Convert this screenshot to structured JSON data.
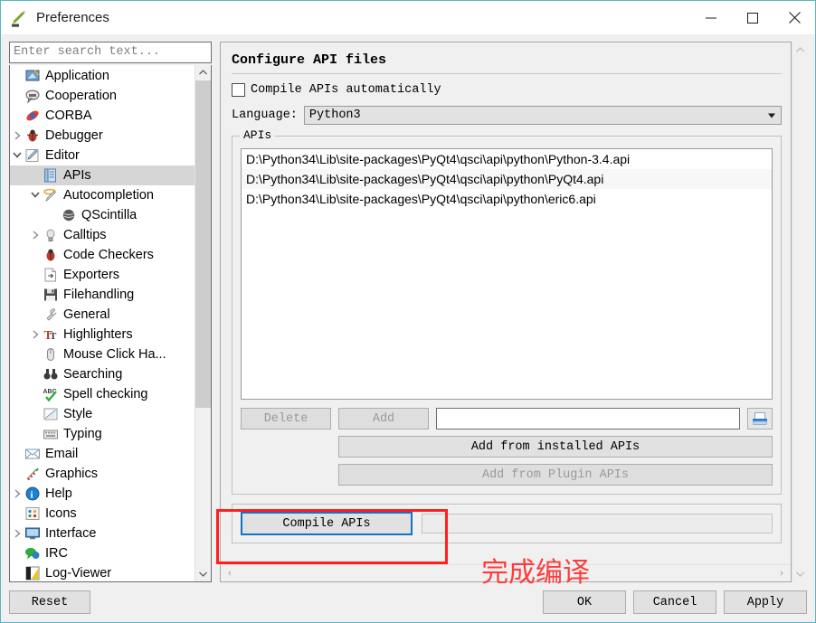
{
  "window": {
    "title": "Preferences",
    "app_icon": "eric6-pen-icon",
    "controls": {
      "minimize": "minimize-icon",
      "maximize": "maximize-icon",
      "close": "close-icon"
    }
  },
  "sidebar": {
    "search_placeholder": "Enter search text...",
    "search_value": "",
    "items": [
      {
        "label": "Application",
        "level": 0,
        "twisty": "",
        "icon": "application-icon",
        "selected": false
      },
      {
        "label": "Cooperation",
        "level": 0,
        "twisty": "",
        "icon": "cooperation-icon",
        "selected": false
      },
      {
        "label": "CORBA",
        "level": 0,
        "twisty": "",
        "icon": "corba-icon",
        "selected": false
      },
      {
        "label": "Debugger",
        "level": 0,
        "twisty": "›",
        "icon": "debugger-bug-icon",
        "selected": false
      },
      {
        "label": "Editor",
        "level": 0,
        "twisty": "⌄",
        "icon": "editor-pencil-icon",
        "selected": false
      },
      {
        "label": "APIs",
        "level": 1,
        "twisty": "",
        "icon": "apis-icon",
        "selected": true
      },
      {
        "label": "Autocompletion",
        "level": 1,
        "twisty": "⌄",
        "icon": "autocompletion-icon",
        "selected": false
      },
      {
        "label": "QScintilla",
        "level": 2,
        "twisty": "",
        "icon": "qscintilla-icon",
        "selected": false
      },
      {
        "label": "Calltips",
        "level": 1,
        "twisty": "›",
        "icon": "calltips-bulb-icon",
        "selected": false
      },
      {
        "label": "Code Checkers",
        "level": 1,
        "twisty": "",
        "icon": "code-checkers-icon",
        "selected": false
      },
      {
        "label": "Exporters",
        "level": 1,
        "twisty": "",
        "icon": "exporters-icon",
        "selected": false
      },
      {
        "label": "Filehandling",
        "level": 1,
        "twisty": "",
        "icon": "filehandling-icon",
        "selected": false
      },
      {
        "label": "General",
        "level": 1,
        "twisty": "",
        "icon": "general-wrench-icon",
        "selected": false
      },
      {
        "label": "Highlighters",
        "level": 1,
        "twisty": "›",
        "icon": "highlighters-icon",
        "selected": false
      },
      {
        "label": "Mouse Click Ha...",
        "level": 1,
        "twisty": "",
        "icon": "mouse-icon",
        "selected": false
      },
      {
        "label": "Searching",
        "level": 1,
        "twisty": "",
        "icon": "searching-binoculars-icon",
        "selected": false
      },
      {
        "label": "Spell checking",
        "level": 1,
        "twisty": "",
        "icon": "spell-checking-icon",
        "selected": false
      },
      {
        "label": "Style",
        "level": 1,
        "twisty": "",
        "icon": "style-icon",
        "selected": false
      },
      {
        "label": "Typing",
        "level": 1,
        "twisty": "",
        "icon": "typing-keyboard-icon",
        "selected": false
      },
      {
        "label": "Email",
        "level": 0,
        "twisty": "",
        "icon": "email-icon",
        "selected": false
      },
      {
        "label": "Graphics",
        "level": 0,
        "twisty": "",
        "icon": "graphics-icon",
        "selected": false
      },
      {
        "label": "Help",
        "level": 0,
        "twisty": "›",
        "icon": "help-icon",
        "selected": false
      },
      {
        "label": "Icons",
        "level": 0,
        "twisty": "",
        "icon": "icons-icon",
        "selected": false
      },
      {
        "label": "Interface",
        "level": 0,
        "twisty": "›",
        "icon": "interface-monitor-icon",
        "selected": false
      },
      {
        "label": "IRC",
        "level": 0,
        "twisty": "",
        "icon": "irc-icon",
        "selected": false
      },
      {
        "label": "Log-Viewer",
        "level": 0,
        "twisty": "",
        "icon": "log-viewer-icon",
        "selected": false
      }
    ]
  },
  "main": {
    "pane_title": "Configure API files",
    "compile_auto": {
      "label": "Compile APIs automatically",
      "checked": false
    },
    "language": {
      "label": "Language:",
      "value": "Python3"
    },
    "apis_group": {
      "legend": "APIs",
      "files": [
        "D:\\Python34\\Lib\\site-packages\\PyQt4\\qsci\\api\\python\\Python-3.4.api",
        "D:\\Python34\\Lib\\site-packages\\PyQt4\\qsci\\api\\python\\PyQt4.api",
        "D:\\Python34\\Lib\\site-packages\\PyQt4\\qsci\\api\\python\\eric6.api"
      ],
      "delete_label": "Delete",
      "delete_enabled": false,
      "add_label": "Add",
      "add_enabled": false,
      "path_value": "",
      "browse_icon": "open-folder-icon",
      "add_installed_label": "Add from installed APIs",
      "add_installed_enabled": true,
      "add_plugin_label": "Add from Plugin APIs",
      "add_plugin_enabled": false
    },
    "compile_group": {
      "button_label": "Compile APIs",
      "button_focused": true,
      "progress_value": 0
    },
    "annotation": {
      "text": "完成编译",
      "color": "#ff3b3b",
      "box_color": "#ff1f1f"
    }
  },
  "footer": {
    "reset_label": "Reset",
    "ok_label": "OK",
    "cancel_label": "Cancel",
    "apply_label": "Apply"
  },
  "colors": {
    "window_border": "#5bb5c4",
    "panel_bg": "#f0f0f0",
    "selection": "#d6d6d6",
    "focus_blue": "#1273c4"
  }
}
